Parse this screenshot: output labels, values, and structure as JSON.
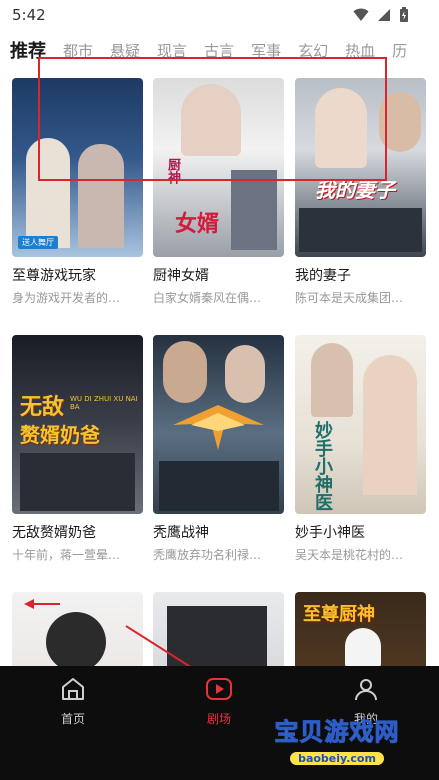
{
  "status": {
    "time": "5:42"
  },
  "tabs": [
    "推荐",
    "都市",
    "悬疑",
    "现言",
    "古言",
    "军事",
    "玄幻",
    "热血",
    "历"
  ],
  "dramas": [
    {
      "title": "至尊游戏玩家",
      "desc": "身为游戏开发者的…",
      "poster_text": ""
    },
    {
      "title": "厨神女婿",
      "desc": "白家女婿秦风在偶…",
      "poster_text": "厨神女婿"
    },
    {
      "title": "我的妻子",
      "desc": "陈可本是天成集团…",
      "poster_text": "我的妻子"
    },
    {
      "title": "无敌赘婿奶爸",
      "desc": "十年前，蒋一萱晕…",
      "poster_text": "无敌赘婿奶爸"
    },
    {
      "title": "秃鹰战神",
      "desc": "秃鹰放弃功名利禄…",
      "poster_text": ""
    },
    {
      "title": "妙手小神医",
      "desc": "吴天本是桃花村的…",
      "poster_text": "妙手小神医"
    },
    {
      "title": "",
      "desc": "",
      "poster_text": ""
    },
    {
      "title": "",
      "desc": "",
      "poster_text": ""
    },
    {
      "title": "",
      "desc": "",
      "poster_text": "至尊厨神"
    }
  ],
  "poster_overlay": {
    "p1_badge": "送人舞厅",
    "p4_pinyin": "WU DI  ZHUI XU NAI BA"
  },
  "nav": {
    "home": "首页",
    "theater": "剧场",
    "mine": "我的"
  },
  "watermark": {
    "title": "宝贝游戏网",
    "url": "baobeiy.com"
  },
  "colors": {
    "active_nav": "#e8323c",
    "annotation": "#d8262f"
  }
}
